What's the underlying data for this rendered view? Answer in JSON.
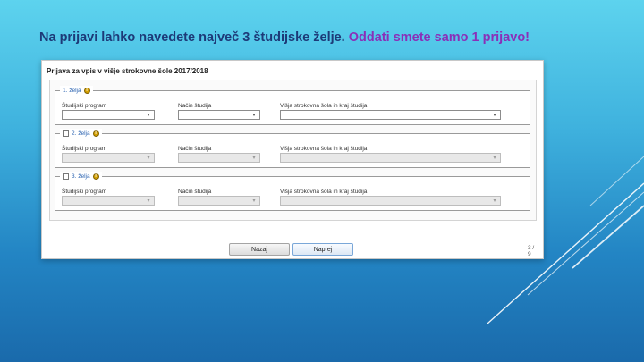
{
  "headline": {
    "main": "Na prijavi lahko navedete največ 3 študijske želje.",
    "accent": "Oddati smete samo 1 prijavo!"
  },
  "panel": {
    "title": "Prijava za vpis v višje strokovne šole 2017/2018"
  },
  "wishes": [
    {
      "legend": "1. želja",
      "has_checkbox": false,
      "enabled": true,
      "fields": [
        "Študijski program",
        "Način študija",
        "Višja strokovna šola in kraj študija"
      ]
    },
    {
      "legend": "2. želja",
      "has_checkbox": true,
      "enabled": false,
      "fields": [
        "Študijski program",
        "Način študija",
        "Višja strokovna šola in kraj študija"
      ]
    },
    {
      "legend": "3. želja",
      "has_checkbox": true,
      "enabled": false,
      "fields": [
        "Študijski program",
        "Način študija",
        "Višja strokovna šola in kraj študija"
      ]
    }
  ],
  "buttons": {
    "back": "Nazaj",
    "next": "Naprej"
  },
  "page_indicator": "3 / 9",
  "icons": {
    "info": "info-icon",
    "dropdown": "chevron-down-icon"
  },
  "colors": {
    "headline": "#1d3a78",
    "accent": "#8a2fb8",
    "legend": "#2a62b0",
    "info": "#d4a000"
  }
}
